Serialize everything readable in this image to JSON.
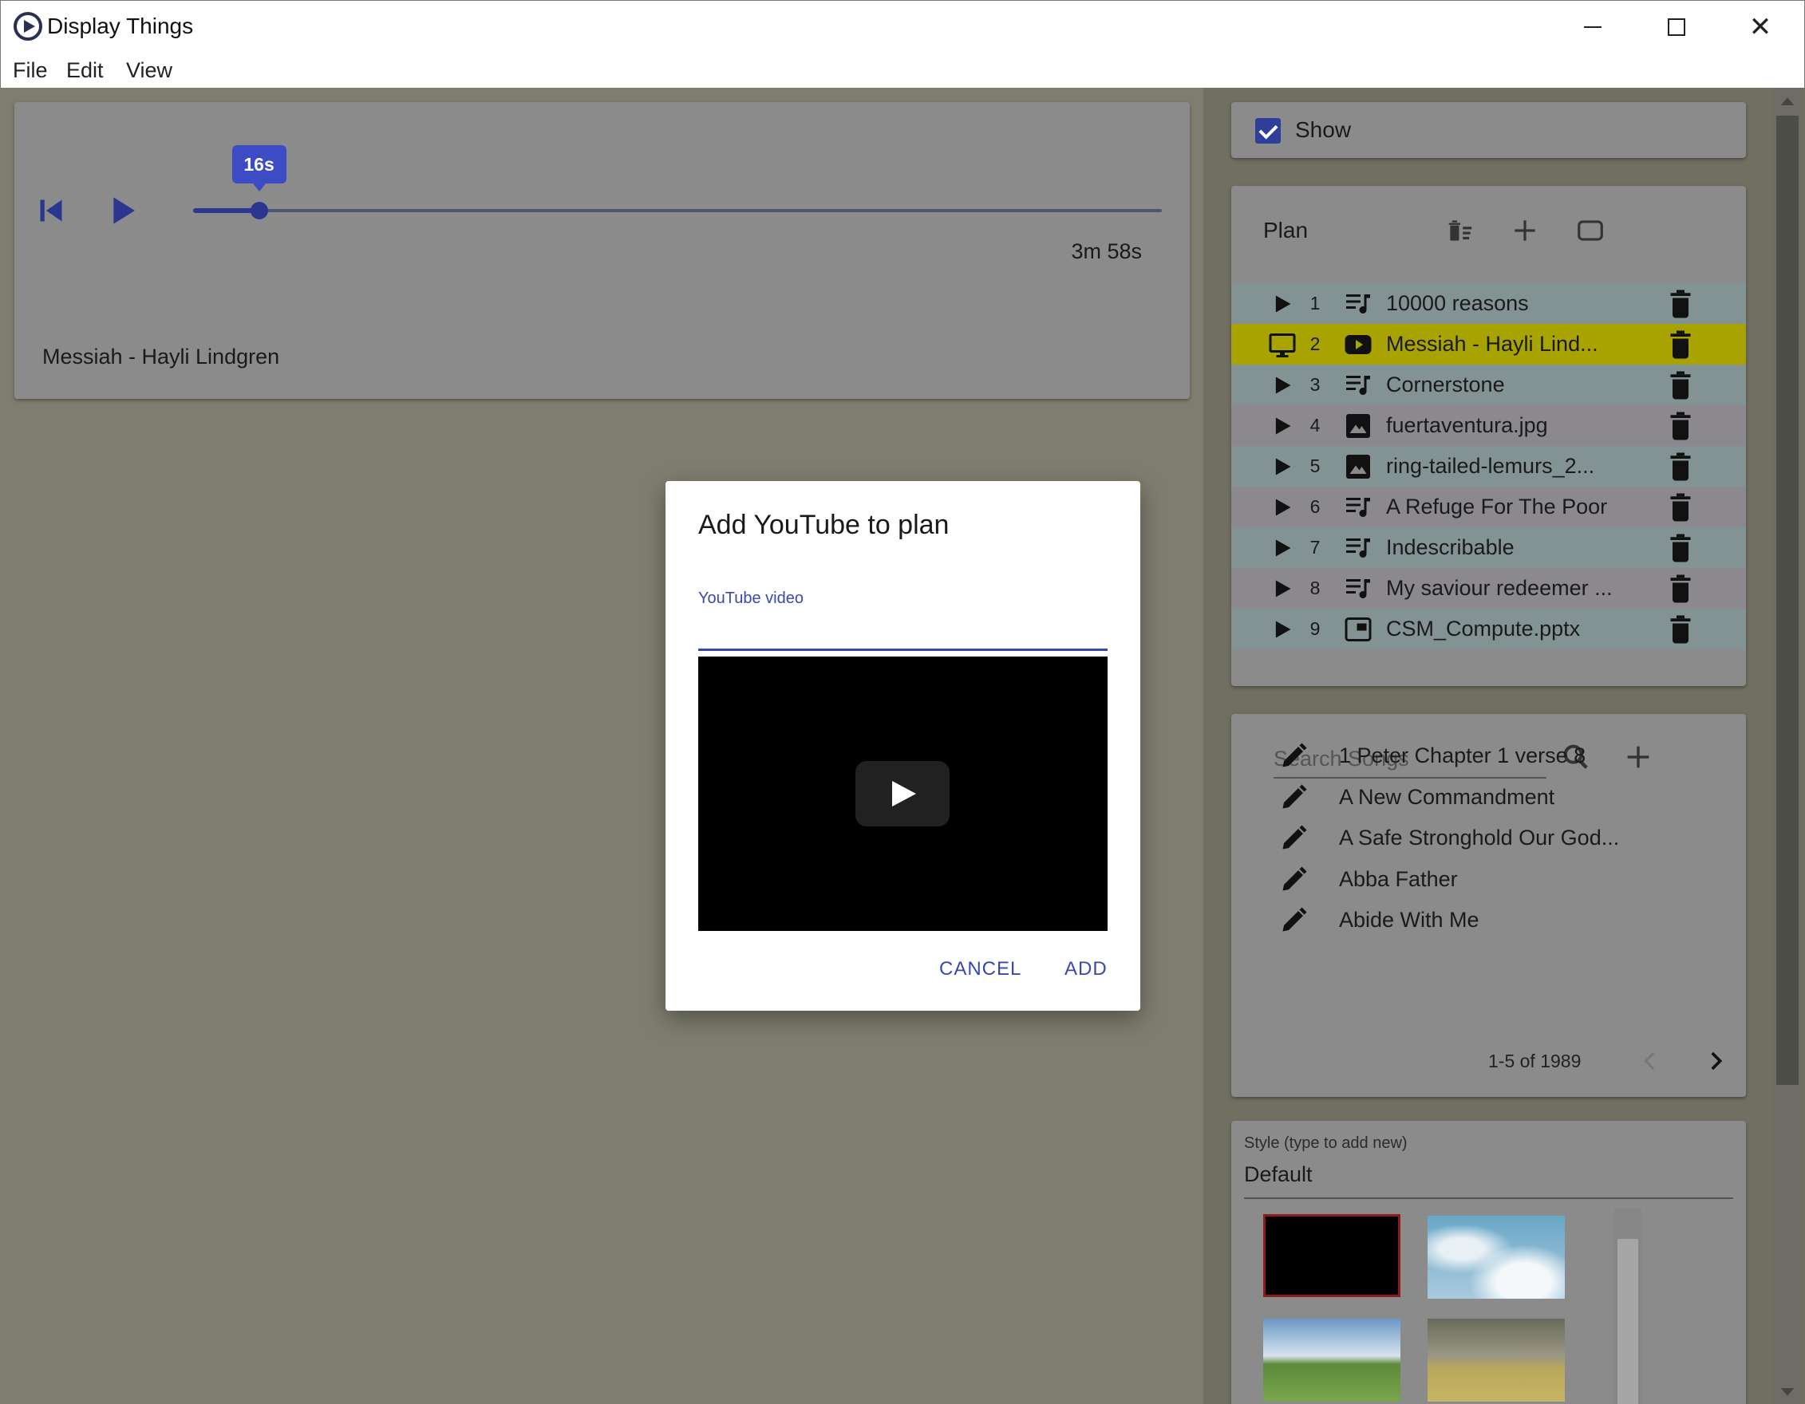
{
  "window": {
    "title": "Display Things",
    "menu": [
      "File",
      "Edit",
      "View"
    ]
  },
  "player": {
    "position_label": "16s",
    "position_fraction": 0.068,
    "duration": "3m 58s",
    "now_playing": "Messiah - Hayli Lindgren"
  },
  "show": {
    "label": "Show",
    "checked": true
  },
  "plan": {
    "title": "Plan",
    "items": [
      {
        "num": "1",
        "type": "song-icon",
        "name": "10000 reasons",
        "state": "idle"
      },
      {
        "num": "2",
        "type": "youtube-icon",
        "name": "Messiah - Hayli Lind...",
        "state": "displaying"
      },
      {
        "num": "3",
        "type": "song-icon",
        "name": "Cornerstone",
        "state": "idle"
      },
      {
        "num": "4",
        "type": "image-icon",
        "name": "fuertaventura.jpg",
        "state": "idle"
      },
      {
        "num": "5",
        "type": "image-icon",
        "name": "ring-tailed-lemurs_2...",
        "state": "idle"
      },
      {
        "num": "6",
        "type": "song-icon",
        "name": "A Refuge For The Poor",
        "state": "idle"
      },
      {
        "num": "7",
        "type": "song-icon",
        "name": "Indescribable",
        "state": "idle"
      },
      {
        "num": "8",
        "type": "song-icon",
        "name": "My saviour redeemer ...",
        "state": "idle"
      },
      {
        "num": "9",
        "type": "presentation-icon",
        "name": "CSM_Compute.pptx",
        "state": "idle"
      }
    ]
  },
  "songs": {
    "search_placeholder": "Search Songs",
    "items": [
      "1 Peter Chapter 1 verse 8",
      "A New Commandment",
      "A Safe Stronghold Our God...",
      "Abba Father",
      "Abide With Me"
    ],
    "pagination": "1-5 of 1989"
  },
  "style": {
    "label": "Style (type to add new)",
    "value": "Default",
    "thumbnails": [
      "black",
      "sky",
      "field",
      "rainbow"
    ]
  },
  "dialog": {
    "title": "Add YouTube to plan",
    "field_label": "YouTube video",
    "field_value": "",
    "cancel": "CANCEL",
    "add": "ADD"
  },
  "colors": {
    "accent": "#3949ab",
    "active_row": "#a8a300",
    "row_alt_1": "#839394",
    "row_alt_2": "#8b898d"
  }
}
